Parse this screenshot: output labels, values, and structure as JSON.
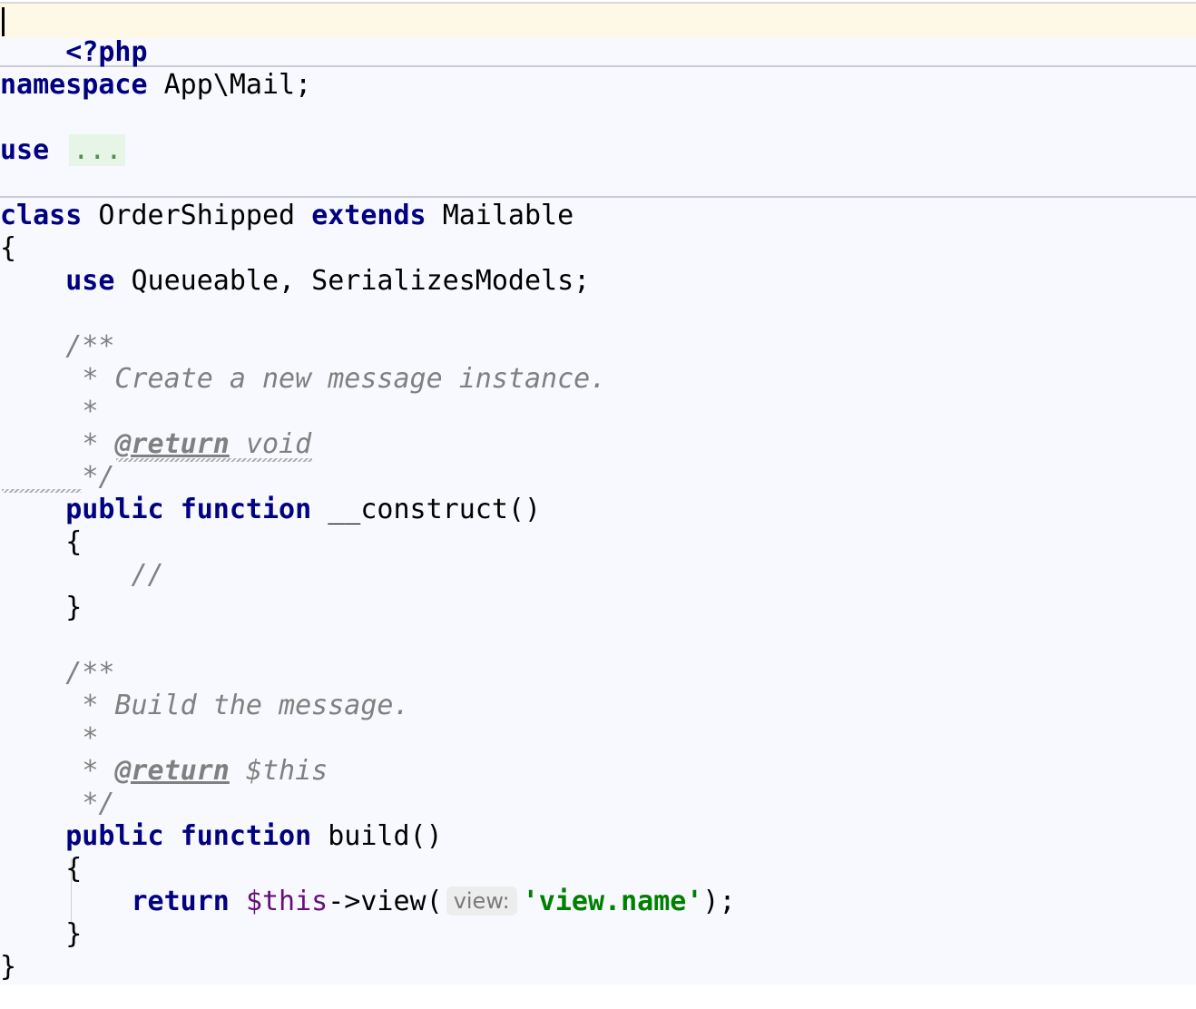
{
  "editor": {
    "language": "php",
    "lines": {
      "php_open": "<?php",
      "namespace_kw": "namespace",
      "namespace_name": "App\\Mail;",
      "use_kw": "use",
      "use_fold": "...",
      "class_kw": "class",
      "class_name": "OrderShipped",
      "extends_kw": "extends",
      "parent_class": "Mailable",
      "open_brace": "{",
      "trait_use_kw": "use",
      "trait_list": "Queueable, SerializesModels;",
      "doc1_open": "/**",
      "doc1_desc": "* Create a new message instance.",
      "doc1_star": "*",
      "doc1_return_prefix": "* ",
      "doc1_return_tag": "@return",
      "doc1_return_type": "void",
      "doc1_close": "*/",
      "ctor_public": "public",
      "ctor_function": "function",
      "ctor_name": "__construct()",
      "ctor_open": "{",
      "ctor_comment": "//",
      "ctor_close": "}",
      "doc2_open": "/**",
      "doc2_desc": "* Build the message.",
      "doc2_star": "*",
      "doc2_return_prefix": "* ",
      "doc2_return_tag": "@return",
      "doc2_return_type": "$this",
      "doc2_close": "*/",
      "build_public": "public",
      "build_function": "function",
      "build_name": "build()",
      "build_open": "{",
      "return_kw": "return",
      "return_this": "$this",
      "return_call": "->view(",
      "param_hint": "view:",
      "return_string": "'view.name'",
      "return_end": ");",
      "build_close": "}",
      "class_close": "}"
    },
    "colors": {
      "keyword": "#000080",
      "comment": "#808080",
      "string": "#008000",
      "variable": "#660e7a",
      "current_line": "#fdf9e6",
      "background": "#f7f9fe"
    }
  }
}
